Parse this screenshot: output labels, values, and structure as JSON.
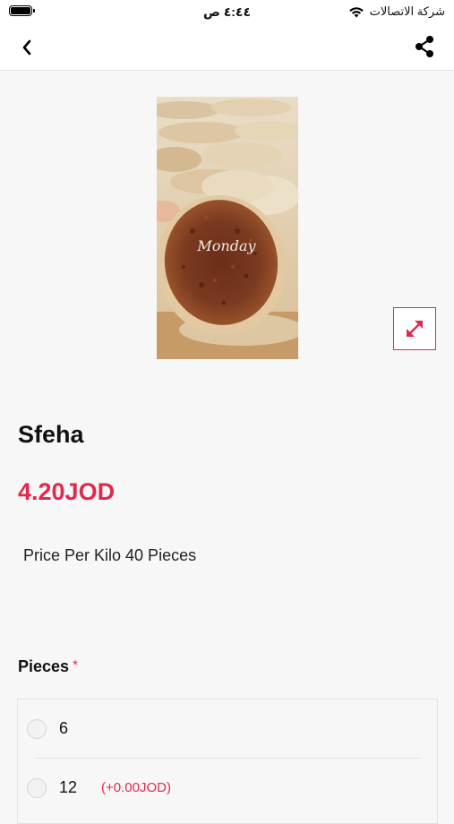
{
  "status_bar": {
    "time": "٤:٤٤ ص",
    "carrier": "شركة الاتصالات"
  },
  "nav": {
    "back_icon": "chevron-left-icon",
    "share_icon": "share-icon"
  },
  "product": {
    "name": "Sfeha",
    "price": "4.20JOD",
    "description": "Price Per Kilo 40 Pieces",
    "image_caption": "Monday",
    "expand_icon": "expand-arrows-icon"
  },
  "options": {
    "title": "Pieces",
    "required_mark": "*",
    "items": [
      {
        "label": "6",
        "extra": ""
      },
      {
        "label": "12",
        "extra": "(+0.00JOD)"
      }
    ]
  },
  "colors": {
    "accent": "#e0294f",
    "background": "#f7f7f7"
  }
}
